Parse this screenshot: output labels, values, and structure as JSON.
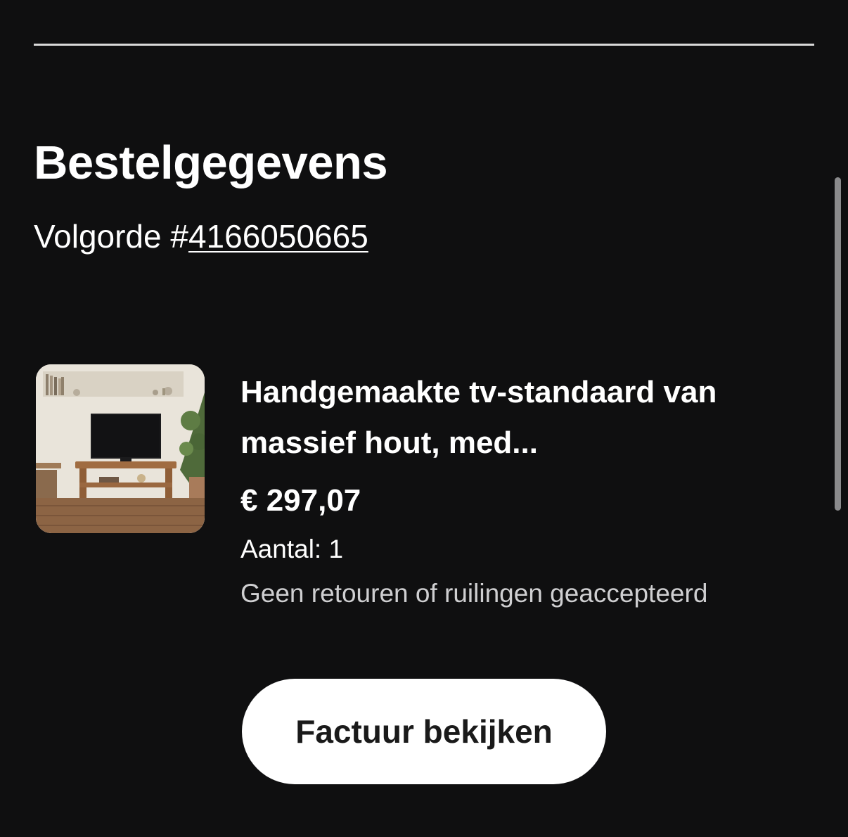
{
  "section": {
    "title": "Bestelgegevens",
    "order_prefix": "Volgorde #",
    "order_number": "4166050665"
  },
  "item": {
    "name": "Handgemaakte tv-standaard van massief hout, med...",
    "price": "€ 297,07",
    "quantity_label": "Aantal: 1",
    "return_policy": "Geen retouren of ruilingen geaccepteerd"
  },
  "actions": {
    "view_invoice_label": "Factuur bekijken"
  },
  "colors": {
    "background": "#0f0f10",
    "text": "#ffffff",
    "muted_text": "#cfcfd1",
    "button_background": "#ffffff",
    "button_text": "#1a1a1a"
  }
}
